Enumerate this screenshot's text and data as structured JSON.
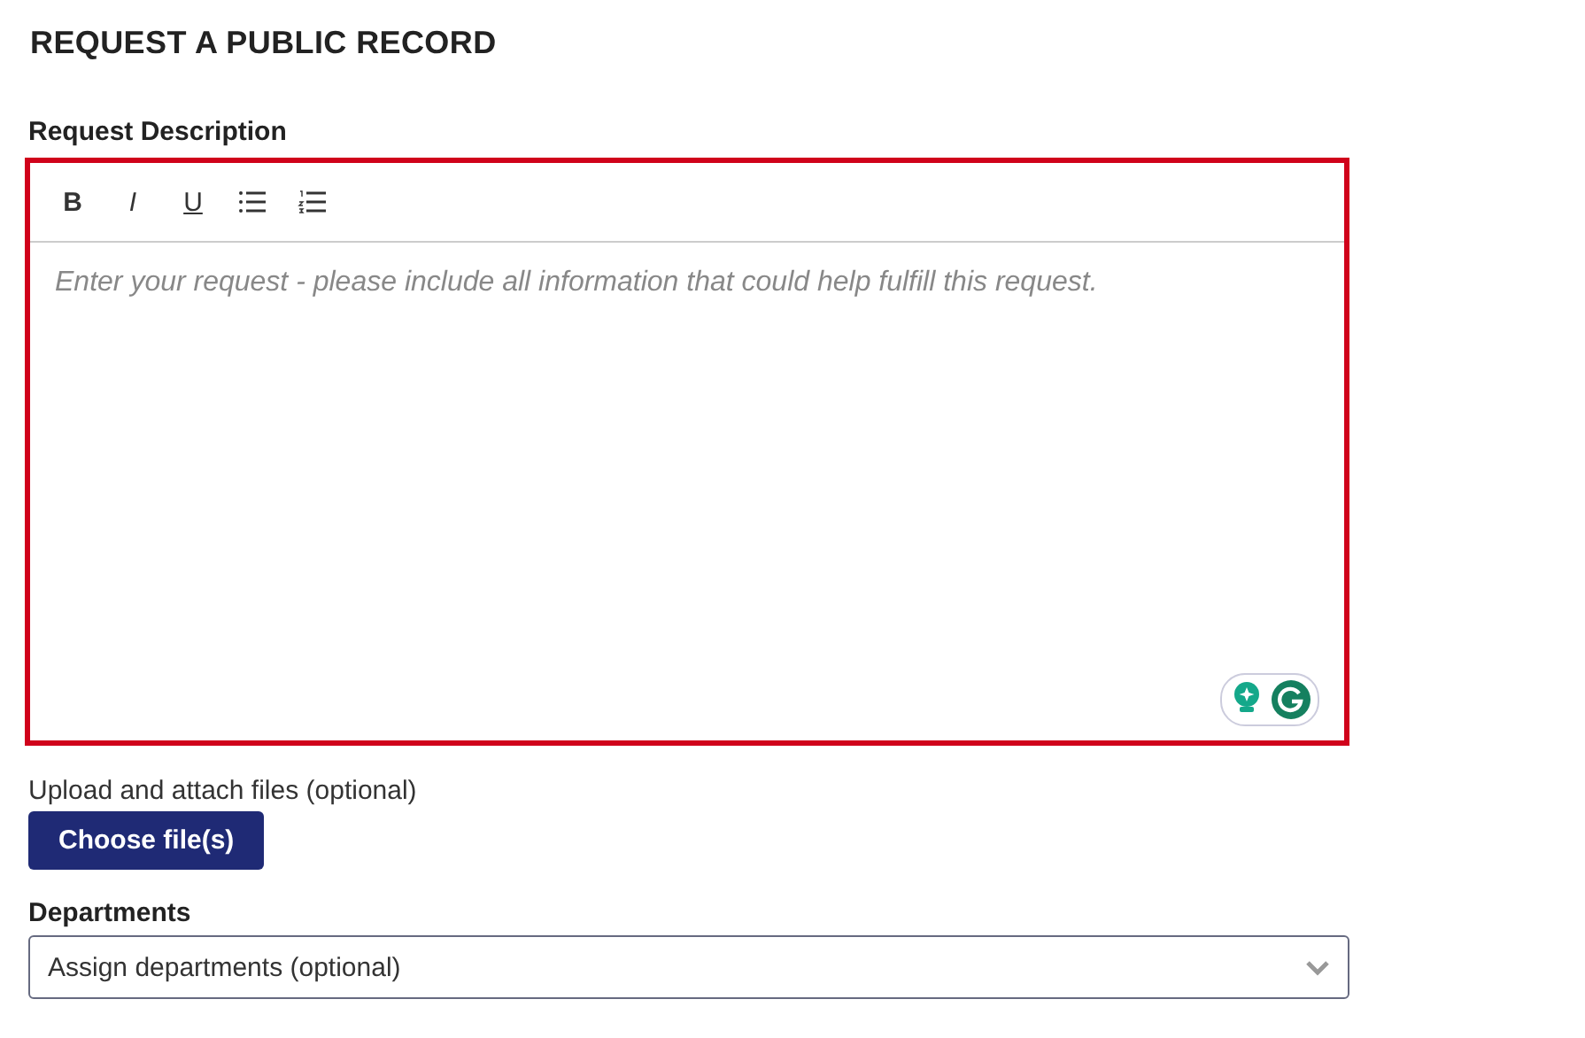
{
  "title": "REQUEST A PUBLIC RECORD",
  "description": {
    "label": "Request Description",
    "invalid": true,
    "toolbar": [
      {
        "kind": "bold",
        "label": "B"
      },
      {
        "kind": "italic",
        "label": "I"
      },
      {
        "kind": "underline",
        "label": "U"
      },
      {
        "kind": "bullet-list"
      },
      {
        "kind": "numbered-list"
      }
    ],
    "placeholder": "Enter your request - please include all information that could help fulfill this request."
  },
  "upload": {
    "label": "Upload and attach files (optional)",
    "button": "Choose file(s)"
  },
  "departments": {
    "label": "Departments",
    "placeholder": "Assign departments (optional)"
  }
}
